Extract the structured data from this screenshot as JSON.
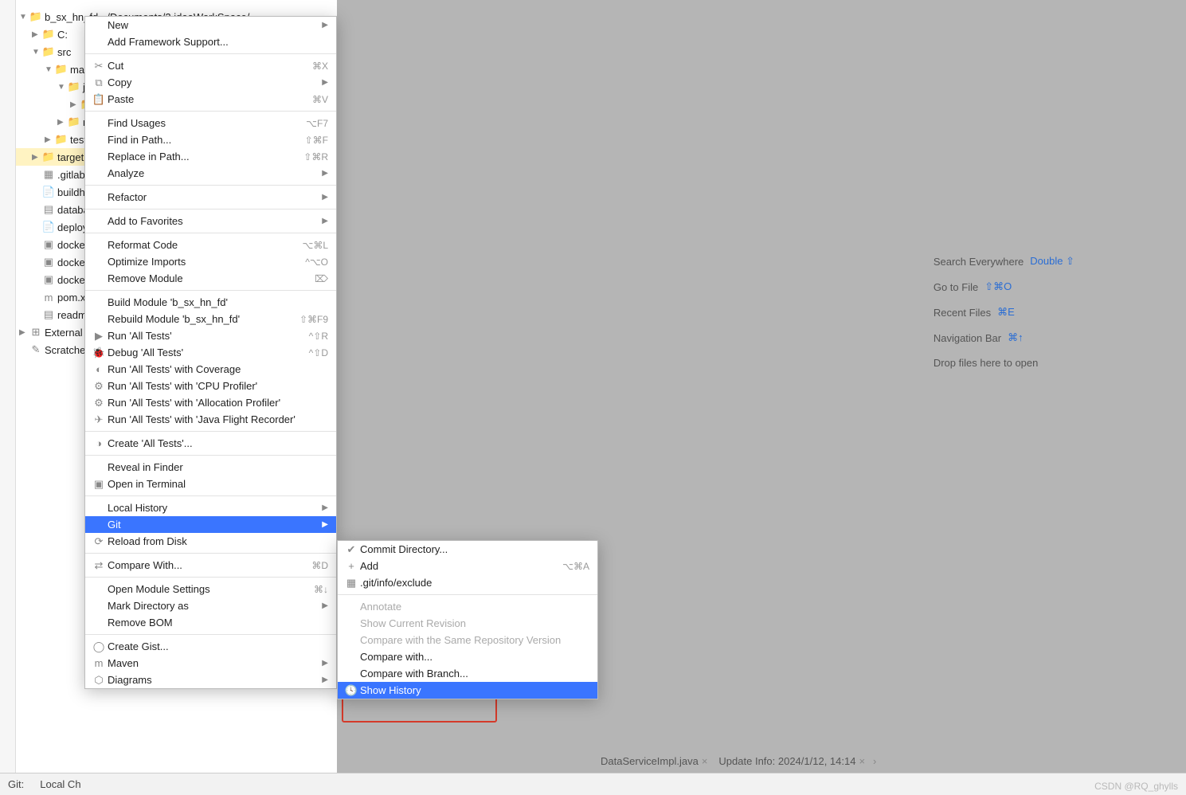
{
  "project": {
    "title": "b_sx_hn_fd",
    "path": "~/Documents/2.ideaWorkSpace/"
  },
  "tree": [
    {
      "depth": 0,
      "arrow": "▼",
      "icon": "folder",
      "label": "b_sx_hn_fd",
      "extra": "~/Documents/2.ideaWorkSpace/",
      "iconClass": "blue-icon"
    },
    {
      "depth": 1,
      "arrow": "▶",
      "icon": "folder",
      "label": "C:"
    },
    {
      "depth": 1,
      "arrow": "▼",
      "icon": "folder",
      "label": "src"
    },
    {
      "depth": 2,
      "arrow": "▼",
      "icon": "folder",
      "label": "main"
    },
    {
      "depth": 3,
      "arrow": "▼",
      "icon": "folder",
      "label": "ja",
      "iconClass": "blue-icon"
    },
    {
      "depth": 4,
      "arrow": "▶",
      "icon": "folder",
      "label": ""
    },
    {
      "depth": 3,
      "arrow": "▶",
      "icon": "folder",
      "label": "re"
    },
    {
      "depth": 2,
      "arrow": "▶",
      "icon": "folder",
      "label": "test"
    },
    {
      "depth": 1,
      "arrow": "▶",
      "icon": "folder",
      "label": "target",
      "hl": true,
      "iconClass": "orange-icon"
    },
    {
      "depth": 1,
      "arrow": "",
      "icon": "yml",
      "label": ".gitlab-c"
    },
    {
      "depth": 1,
      "arrow": "",
      "icon": "file",
      "label": "buildhne"
    },
    {
      "depth": 1,
      "arrow": "",
      "icon": "sql",
      "label": "databas"
    },
    {
      "depth": 1,
      "arrow": "",
      "icon": "file",
      "label": "deploy.s"
    },
    {
      "depth": 1,
      "arrow": "",
      "icon": "dc",
      "label": "docker-"
    },
    {
      "depth": 1,
      "arrow": "",
      "icon": "dc",
      "label": "docker-"
    },
    {
      "depth": 1,
      "arrow": "",
      "icon": "dc",
      "label": "docker-"
    },
    {
      "depth": 1,
      "arrow": "",
      "icon": "m",
      "label": "pom.xm"
    },
    {
      "depth": 1,
      "arrow": "",
      "icon": "md",
      "label": "readme"
    },
    {
      "depth": 0,
      "arrow": "▶",
      "icon": "lib",
      "label": "External Lib"
    },
    {
      "depth": 0,
      "arrow": "",
      "icon": "scratch",
      "label": "Scratches a"
    }
  ],
  "menu": [
    {
      "label": "New",
      "shortcut": "",
      "submenu": true
    },
    {
      "label": "Add Framework Support..."
    },
    {
      "sep": true
    },
    {
      "icon": "cut",
      "label": "Cut",
      "shortcut": "⌘X"
    },
    {
      "icon": "copy",
      "label": "Copy",
      "submenu": true
    },
    {
      "icon": "paste",
      "label": "Paste",
      "shortcut": "⌘V"
    },
    {
      "sep": true
    },
    {
      "label": "Find Usages",
      "shortcut": "⌥F7"
    },
    {
      "label": "Find in Path...",
      "shortcut": "⇧⌘F"
    },
    {
      "label": "Replace in Path...",
      "shortcut": "⇧⌘R"
    },
    {
      "label": "Analyze",
      "submenu": true
    },
    {
      "sep": true
    },
    {
      "label": "Refactor",
      "submenu": true
    },
    {
      "sep": true
    },
    {
      "label": "Add to Favorites",
      "submenu": true
    },
    {
      "sep": true
    },
    {
      "label": "Reformat Code",
      "shortcut": "⌥⌘L"
    },
    {
      "label": "Optimize Imports",
      "shortcut": "^⌥O"
    },
    {
      "label": "Remove Module",
      "shortcut": "⌦"
    },
    {
      "sep": true
    },
    {
      "label": "Build Module 'b_sx_hn_fd'"
    },
    {
      "label": "Rebuild Module 'b_sx_hn_fd'",
      "shortcut": "⇧⌘F9"
    },
    {
      "icon": "run",
      "label": "Run 'All Tests'",
      "shortcut": "^⇧R"
    },
    {
      "icon": "debug",
      "label": "Debug 'All Tests'",
      "shortcut": "^⇧D"
    },
    {
      "icon": "cov",
      "label": "Run 'All Tests' with Coverage"
    },
    {
      "icon": "cpu",
      "label": "Run 'All Tests' with 'CPU Profiler'"
    },
    {
      "icon": "alloc",
      "label": "Run 'All Tests' with 'Allocation Profiler'"
    },
    {
      "icon": "jfr",
      "label": "Run 'All Tests' with 'Java Flight Recorder'"
    },
    {
      "sep": true
    },
    {
      "icon": "create",
      "label": "Create 'All Tests'..."
    },
    {
      "sep": true
    },
    {
      "label": "Reveal in Finder"
    },
    {
      "icon": "term",
      "label": "Open in Terminal"
    },
    {
      "sep": true
    },
    {
      "label": "Local History",
      "submenu": true
    },
    {
      "label": "Git",
      "submenu": true,
      "selected": true
    },
    {
      "icon": "reload",
      "label": "Reload from Disk"
    },
    {
      "sep": true
    },
    {
      "icon": "compare",
      "label": "Compare With...",
      "shortcut": "⌘D"
    },
    {
      "sep": true
    },
    {
      "label": "Open Module Settings",
      "shortcut": "⌘↓"
    },
    {
      "label": "Mark Directory as",
      "submenu": true
    },
    {
      "label": "Remove BOM"
    },
    {
      "sep": true
    },
    {
      "icon": "github",
      "label": "Create Gist..."
    },
    {
      "icon": "maven",
      "label": "Maven",
      "submenu": true
    },
    {
      "icon": "diagram",
      "label": "Diagrams",
      "submenu": true
    }
  ],
  "submenu": [
    {
      "icon": "commit",
      "label": "Commit Directory..."
    },
    {
      "icon": "add",
      "label": "Add",
      "shortcut": "⌥⌘A"
    },
    {
      "icon": "exclude",
      "label": ".git/info/exclude"
    },
    {
      "sep": true
    },
    {
      "label": "Annotate",
      "disabled": true
    },
    {
      "label": "Show Current Revision",
      "disabled": true
    },
    {
      "label": "Compare with the Same Repository Version",
      "disabled": true
    },
    {
      "label": "Compare with..."
    },
    {
      "label": "Compare with Branch..."
    },
    {
      "icon": "history",
      "label": "Show History",
      "selected": true
    }
  ],
  "welcome": {
    "search": {
      "label": "Search Everywhere",
      "kb": "Double ⇧"
    },
    "goto": {
      "label": "Go to File",
      "kb": "⇧⌘O"
    },
    "recent": {
      "label": "Recent Files",
      "kb": "⌘E"
    },
    "nav": {
      "label": "Navigation Bar",
      "kb": "⌘↑"
    },
    "drop": {
      "label": "Drop files here to open"
    }
  },
  "bottom": {
    "git": "Git:",
    "local": "Local Ch"
  },
  "tabs": {
    "t1": "DataServiceImpl.java",
    "t2": "Update Info: 2024/1/12, 14:14"
  },
  "watermark": "CSDN @RQ_ghylls"
}
